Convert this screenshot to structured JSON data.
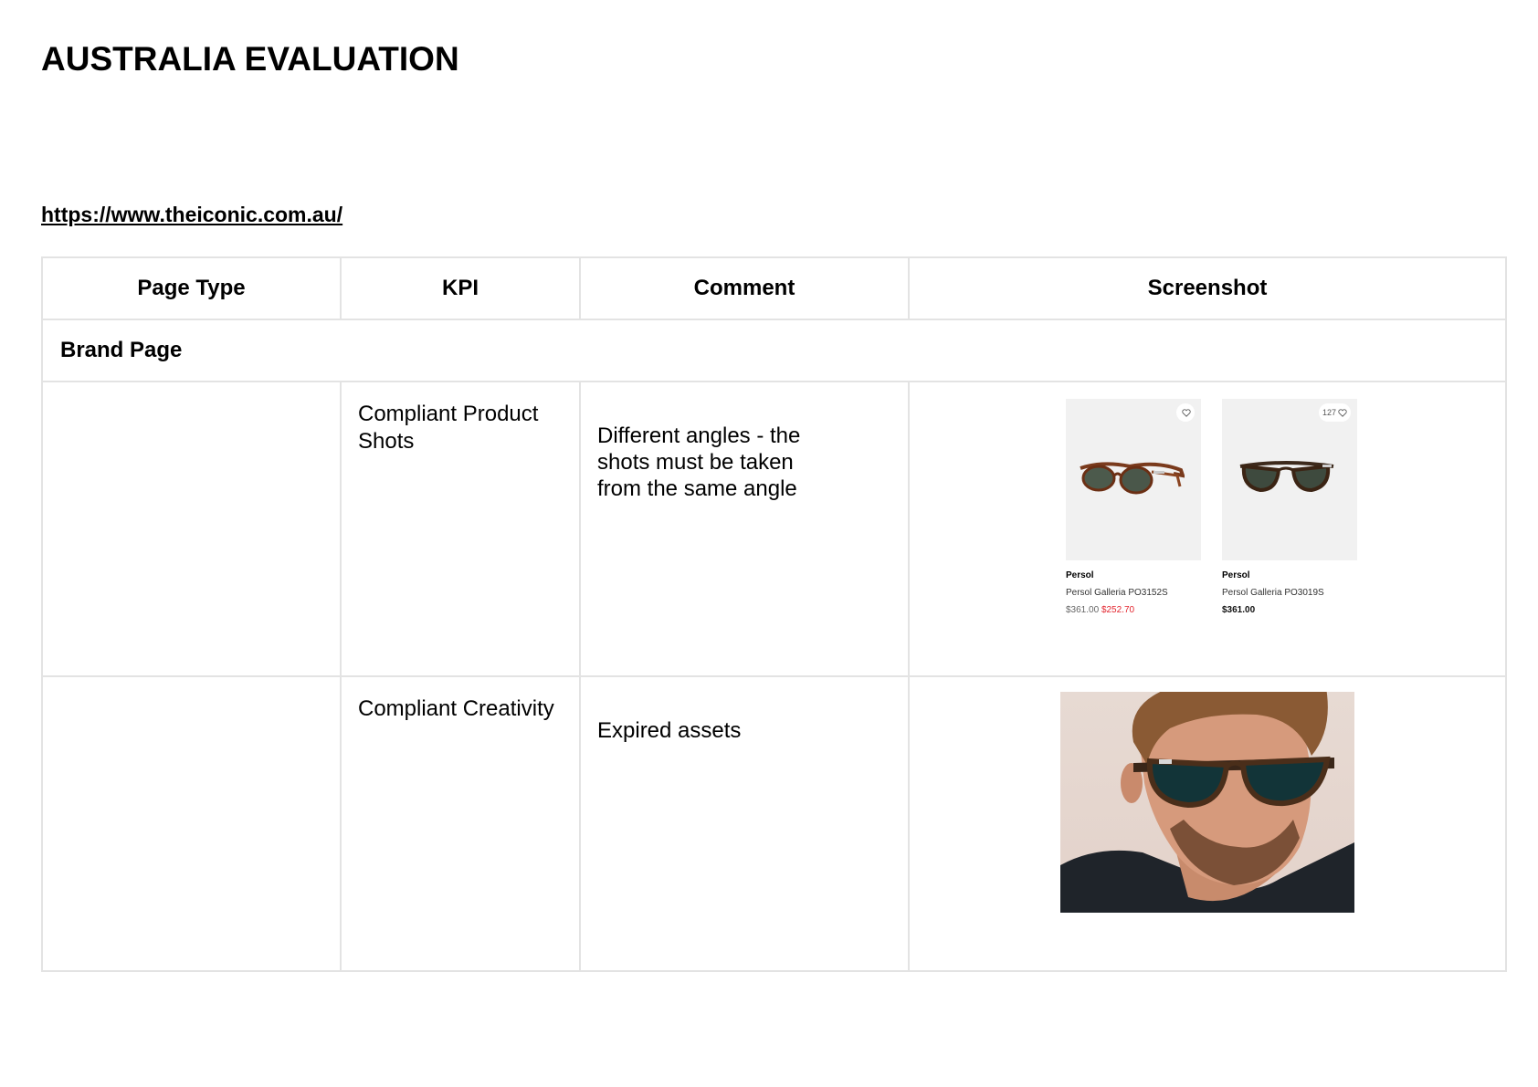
{
  "document": {
    "title": "AUSTRALIA EVALUATION",
    "url": "https://www.theiconic.com.au/"
  },
  "table": {
    "headers": [
      "Page Type",
      "KPI",
      "Comment",
      "Screenshot"
    ],
    "section": "Brand Page",
    "rows": [
      {
        "page_type": "",
        "kpi": "Compliant Product Shots",
        "comment": "Different angles - the shots must be taken from the same angle",
        "screenshot": {
          "cards": [
            {
              "fav": "",
              "brand": "Persol",
              "name": "Persol Galleria PO3152S",
              "price_old": "$361.00",
              "price_sale": "$252.70"
            },
            {
              "fav": "127",
              "brand": "Persol",
              "name": "Persol Galleria PO3019S",
              "price": "$361.00"
            }
          ]
        }
      },
      {
        "page_type": "",
        "kpi": "Compliant Creativity",
        "comment": "Expired assets"
      }
    ]
  }
}
